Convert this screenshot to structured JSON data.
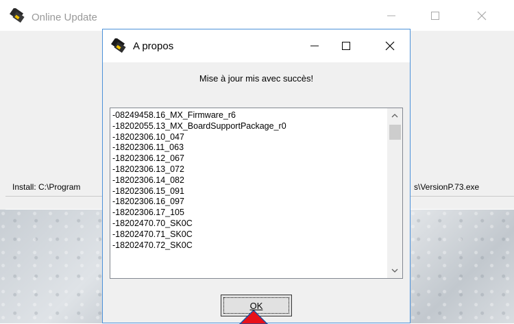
{
  "background_window": {
    "title": "Online Update",
    "install_label": "Install: C:\\Program",
    "install_path_tail": "s\\VersionP.73.exe"
  },
  "dialog": {
    "title": "A propos",
    "message": "Mise à jour mis avec succès!",
    "list_items": [
      "-08249458.16_MX_Firmware_r6",
      "-18202055.13_MX_BoardSupportPackage_r0",
      "-18202306.10_047",
      "-18202306.11_063",
      "-18202306.12_067",
      "-18202306.13_072",
      "-18202306.14_082",
      "-18202306.15_091",
      "-18202306.16_097",
      "-18202306.17_105",
      "-18202470.70_SK0C",
      "-18202470.71_SK0C",
      "-18202470.72_SK0C"
    ],
    "ok_label": "OK"
  },
  "icons": {
    "app": "diskette-chip-icon",
    "minimize": "minimize-icon",
    "maximize": "maximize-icon",
    "close": "close-icon",
    "scroll_up": "chevron-up-icon",
    "scroll_down": "chevron-down-icon",
    "annotation": "red-arrow-icon"
  },
  "colors": {
    "dialog_border": "#4a90d9",
    "annotation_arrow": "#e8101a",
    "window_bg": "#f0f0f0"
  }
}
